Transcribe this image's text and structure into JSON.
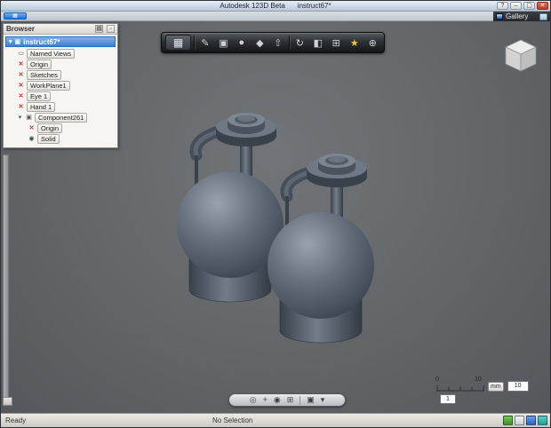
{
  "titlebar": {
    "app_title": "Autodesk 123D Beta",
    "doc_title": "instruct67*",
    "help_glyph": "?",
    "minimize_glyph": "–",
    "maximize_glyph": "▢",
    "close_glyph": "✕"
  },
  "menubar": {
    "app_menu_glyph": "▦",
    "gallery_label": "Gallery"
  },
  "browser": {
    "header": "Browser",
    "options_glyph": "▤",
    "collapse_glyph": "▫",
    "root": {
      "arrow": "▾",
      "icon": "▣",
      "label": "instruct67*"
    },
    "items": [
      {
        "icon": "▭",
        "label": "Named Views"
      },
      {
        "icon": "✕",
        "label": "Origin"
      },
      {
        "icon": "✕",
        "label": "Sketches"
      },
      {
        "icon": "✕",
        "label": "WorkPlane1"
      },
      {
        "icon": "✕",
        "label": "Eye 1"
      },
      {
        "icon": "✕",
        "label": "Hand 1"
      },
      {
        "arrow": "▾",
        "icon": "▣",
        "label": "Component261"
      },
      {
        "icon": "✕",
        "label": "Origin"
      },
      {
        "icon": "◉",
        "label": "Solid"
      }
    ]
  },
  "toolbar": {
    "menu_glyph": "▦",
    "items": [
      {
        "name": "sketch",
        "glyph": "✎"
      },
      {
        "name": "primitive-box",
        "glyph": "▣"
      },
      {
        "name": "primitive-sphere",
        "glyph": "●"
      },
      {
        "name": "primitive-cylinder",
        "glyph": "◆"
      },
      {
        "name": "extrude",
        "glyph": "⇧"
      },
      {
        "name": "revolve",
        "glyph": "↻"
      },
      {
        "name": "split",
        "glyph": "◧"
      },
      {
        "name": "combine",
        "glyph": "⊞"
      },
      {
        "name": "material",
        "glyph": "★"
      },
      {
        "name": "snap",
        "glyph": "⊕"
      }
    ]
  },
  "navbar": {
    "items": [
      {
        "name": "orbit",
        "glyph": "◎"
      },
      {
        "name": "pan",
        "glyph": "+"
      },
      {
        "name": "zoom",
        "glyph": "◉"
      },
      {
        "name": "fit",
        "glyph": "⊞"
      },
      {
        "name": "look-at",
        "glyph": "▣"
      },
      {
        "name": "more",
        "glyph": "▾"
      }
    ]
  },
  "scale": {
    "tick_min": "0",
    "tick_max": "10",
    "unit": "mm",
    "value": "10",
    "factor": "1"
  },
  "statusbar": {
    "ready": "Ready",
    "selection": "No Selection"
  },
  "colors": {
    "selection_blue": "#3d7fd0",
    "model_gray": "#5d6874",
    "viewport_gray": "#636669",
    "star_yellow": "#e9c83c",
    "tray_green": "#4a9a34",
    "tray_blue": "#2a5fc0",
    "tray_teal": "#1e9a94"
  }
}
